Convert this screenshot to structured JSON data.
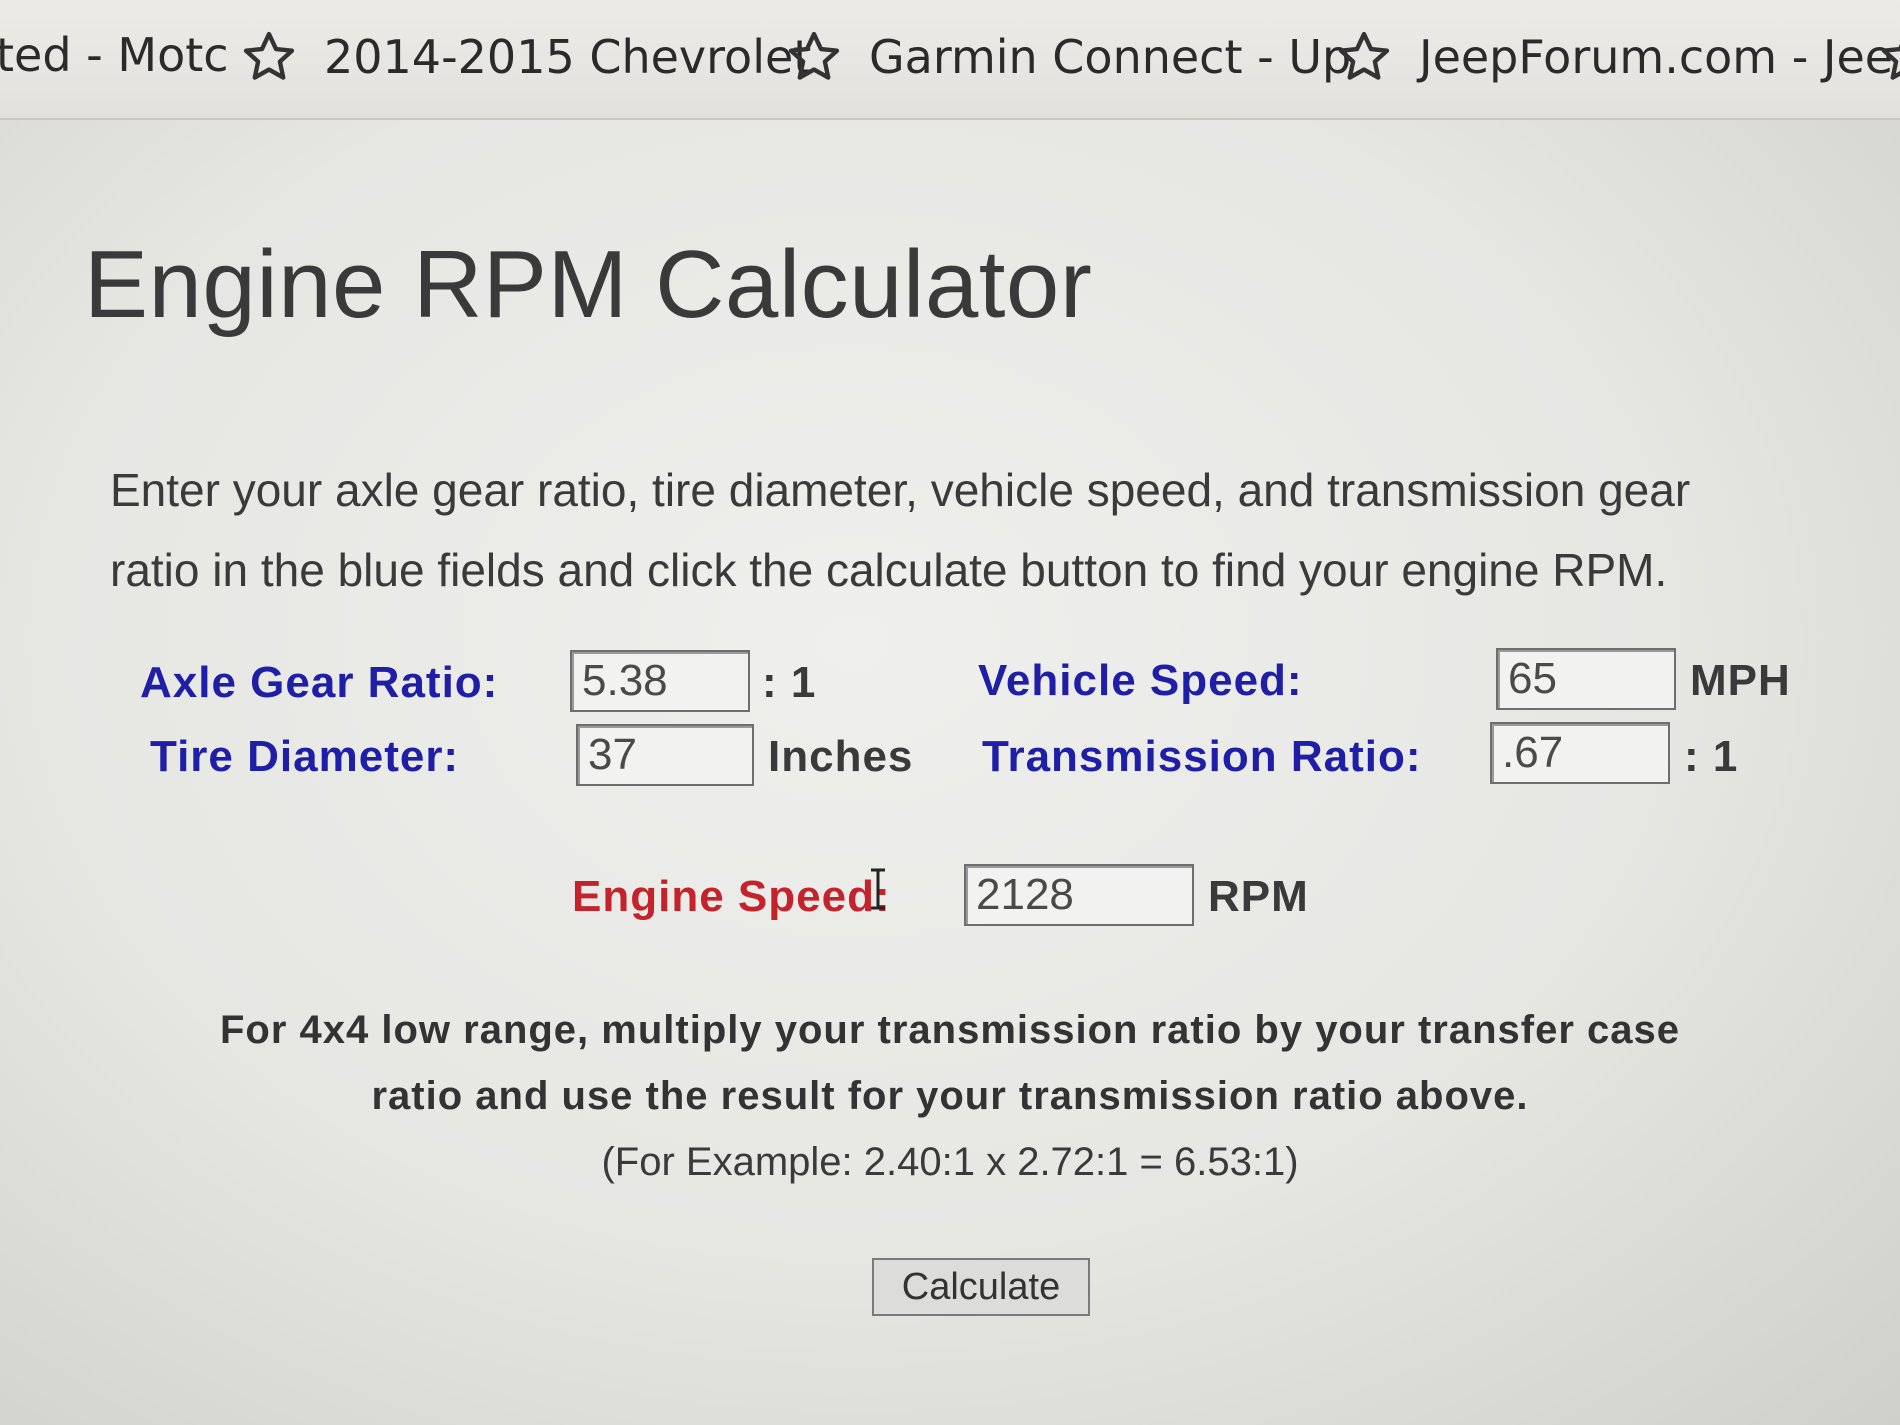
{
  "bookmarks": [
    {
      "label": "ted - Motc",
      "star": false
    },
    {
      "label": "2014-2015 Chevrolet",
      "star": true
    },
    {
      "label": "Garmin Connect - Up",
      "star": true
    },
    {
      "label": "JeepForum.com - Jee",
      "star": true
    },
    {
      "label": "",
      "star": true
    }
  ],
  "page": {
    "title": "Engine RPM Calculator",
    "intro_line1": "Enter your axle gear ratio, tire diameter, vehicle speed, and transmission gear",
    "intro_line2": "ratio in the blue fields and click the calculate button to find your engine RPM."
  },
  "form": {
    "axle_gear_ratio": {
      "label": "Axle Gear Ratio:",
      "value": "5.38",
      "unit": ": 1"
    },
    "tire_diameter": {
      "label": "Tire Diameter:",
      "value": "37",
      "unit": "Inches"
    },
    "vehicle_speed": {
      "label": "Vehicle Speed:",
      "value": "65",
      "unit": "MPH"
    },
    "transmission_ratio": {
      "label": "Transmission Ratio:",
      "value": ".67",
      "unit": ": 1"
    },
    "engine_speed": {
      "label": "Engine Speed:",
      "value": "2128",
      "unit": "RPM"
    }
  },
  "note": {
    "line1": "For 4x4 low range, multiply your transmission ratio by your transfer case",
    "line2": "ratio and use the result for your transmission ratio above.",
    "example": "(For Example: 2.40:1 x 2.72:1 = 6.53:1)"
  },
  "calculate_button": {
    "label": "Calculate"
  },
  "colors": {
    "input_label": "#1e1ea6",
    "result_label": "#c5232b"
  },
  "icons": {
    "bookmark": "star-outline-icon",
    "cursor": "text-cursor-icon"
  }
}
